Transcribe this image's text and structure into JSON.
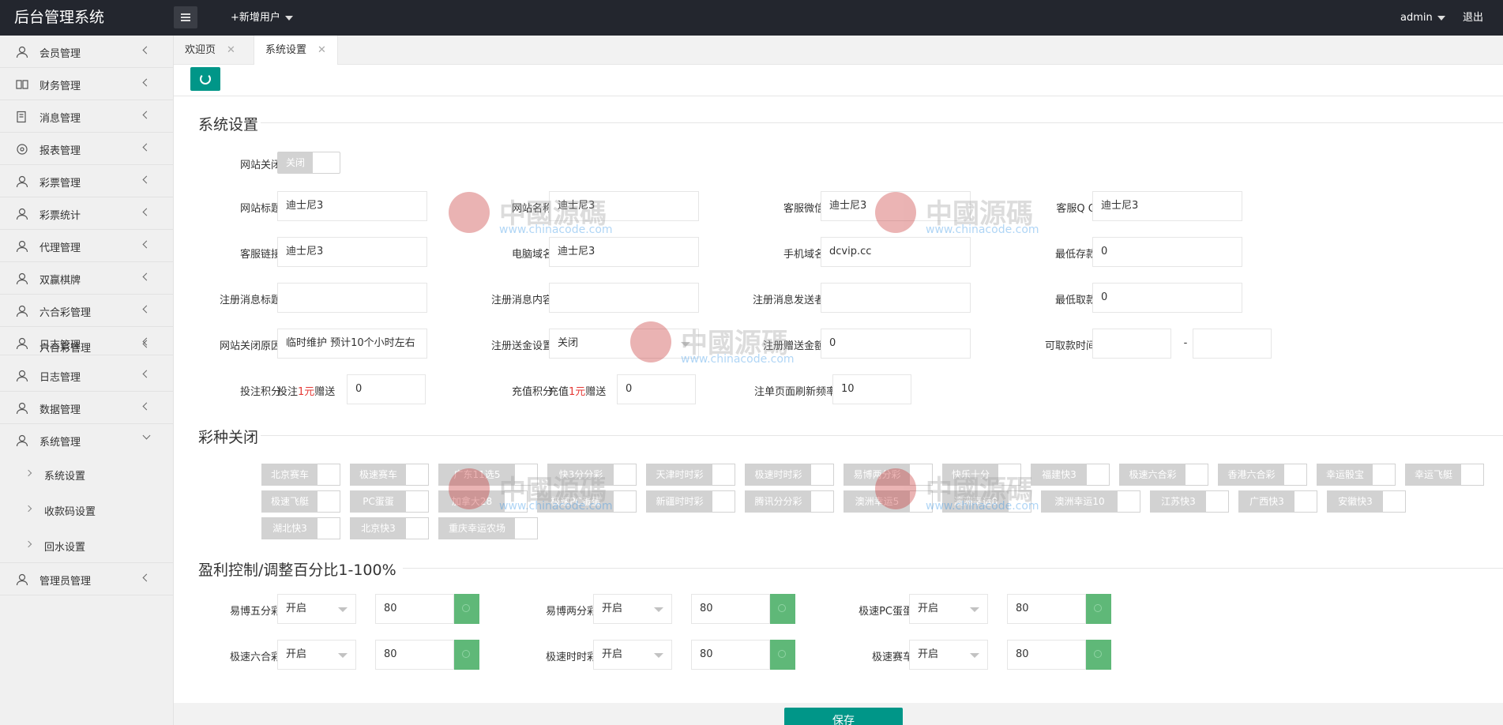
{
  "header": {
    "app_title": "后台管理系统",
    "add_user": "+新增用户",
    "user": "admin",
    "logout": "退出"
  },
  "sidebar": {
    "items": [
      {
        "label": "会员管理",
        "icon": "user-icon"
      },
      {
        "label": "财务管理",
        "icon": "book-icon"
      },
      {
        "label": "消息管理",
        "icon": "message-icon"
      },
      {
        "label": "报表管理",
        "icon": "report-icon"
      },
      {
        "label": "彩票管理",
        "icon": "user-icon"
      },
      {
        "label": "彩票统计",
        "icon": "user-icon"
      },
      {
        "label": "代理管理",
        "icon": "user-icon"
      },
      {
        "label": "双赢棋牌",
        "icon": "user-icon"
      },
      {
        "label": "六合彩管理",
        "icon": "user-icon"
      },
      {
        "label": "日志管理",
        "icon": "user-icon"
      },
      {
        "label": "六合彩管理",
        "icon": "user-icon"
      },
      {
        "label": "日志管理",
        "icon": "user-icon"
      },
      {
        "label": "数据管理",
        "icon": "user-icon"
      },
      {
        "label": "系统管理",
        "icon": "user-icon"
      }
    ],
    "sub_items": [
      {
        "label": "系统设置"
      },
      {
        "label": "收款码设置"
      },
      {
        "label": "回水设置"
      }
    ],
    "last_item": {
      "label": "管理员管理",
      "icon": "user-icon"
    }
  },
  "tabs": [
    {
      "label": "欢迎页"
    },
    {
      "label": "系统设置"
    }
  ],
  "system": {
    "title": "系统设置",
    "site_close_label": "网站关闭",
    "site_close_value": "关闭",
    "fields": {
      "site_title": {
        "label": "网站标题",
        "value": "迪士尼3"
      },
      "site_name": {
        "label": "网站名称",
        "value": "迪士尼3"
      },
      "wechat": {
        "label": "客服微信",
        "value": "迪士尼3"
      },
      "qq": {
        "label": "客服Q Q",
        "value": "迪士尼3"
      },
      "service_link": {
        "label": "客服链接",
        "value": "迪士尼3"
      },
      "pc_domain": {
        "label": "电脑域名",
        "value": "迪士尼3"
      },
      "mobile_domain": {
        "label": "手机域名",
        "value": "dcvip.cc"
      },
      "min_deposit": {
        "label": "最低存款",
        "value": "0"
      },
      "reg_msg_title": {
        "label": "注册消息标题",
        "value": ""
      },
      "reg_msg_content": {
        "label": "注册消息内容",
        "value": ""
      },
      "reg_msg_sender": {
        "label": "注册消息发送者",
        "value": ""
      },
      "min_withdraw": {
        "label": "最低取款",
        "value": "0"
      },
      "close_reason": {
        "label": "网站关闭原因",
        "value": "临时维护 预计10个小时左右"
      },
      "reg_bonus_setting": {
        "label": "注册送金设置",
        "value": "关闭"
      },
      "reg_bonus_amount": {
        "label": "注册赠送金额",
        "value": "0"
      },
      "withdraw_time": {
        "label": "可取款时间",
        "from": "",
        "sep": "-",
        "to": ""
      },
      "bet_points": {
        "label": "投注积分",
        "prefix": "投注",
        "amount": "1元",
        "suffix": "赠送",
        "value": "0"
      },
      "recharge_points": {
        "label": "充值积分",
        "prefix": "充值",
        "amount": "1元",
        "suffix": "赠送",
        "value": "0"
      },
      "refresh_rate": {
        "label": "注单页面刷新频率",
        "value": "10"
      }
    }
  },
  "lottery": {
    "title": "彩种关闭",
    "items": [
      "北京赛车",
      "极速赛车",
      "广东11选5",
      "快3分分彩",
      "天津时时彩",
      "极速时时彩",
      "易博两分彩",
      "快乐十分",
      "福建快3",
      "极速六合彩",
      "香港六合彩",
      "幸运骰宝",
      "幸运飞艇",
      "极速飞艇",
      "PC蛋蛋",
      "加拿大28",
      "极速PC蛋蛋",
      "新疆时时彩",
      "腾讯分分彩",
      "澳洲幸运5",
      "澳洲幸运8",
      "澳洲幸运10",
      "江苏快3",
      "广西快3",
      "安徽快3",
      "湖北快3",
      "北京快3",
      "重庆幸运农场"
    ]
  },
  "profit": {
    "title": "盈利控制/调整百分比1-100%",
    "rows": [
      {
        "label": "易博五分彩",
        "status": "开启",
        "value": "80"
      },
      {
        "label": "易博两分彩",
        "status": "开启",
        "value": "80"
      },
      {
        "label": "极速PC蛋蛋",
        "status": "开启",
        "value": "80"
      },
      {
        "label": "极速六合彩",
        "status": "开启",
        "value": "80"
      },
      {
        "label": "极速时时彩",
        "status": "开启",
        "value": "80"
      },
      {
        "label": "极速赛车",
        "status": "开启",
        "value": "80"
      }
    ]
  },
  "actions": {
    "save": "保存"
  },
  "watermark": {
    "text": "中國源碼",
    "url": "www.chinacode.com"
  },
  "colors": {
    "topbar": "#23262e",
    "accent": "#009688",
    "green": "#5fb878",
    "red": "#e53935"
  }
}
